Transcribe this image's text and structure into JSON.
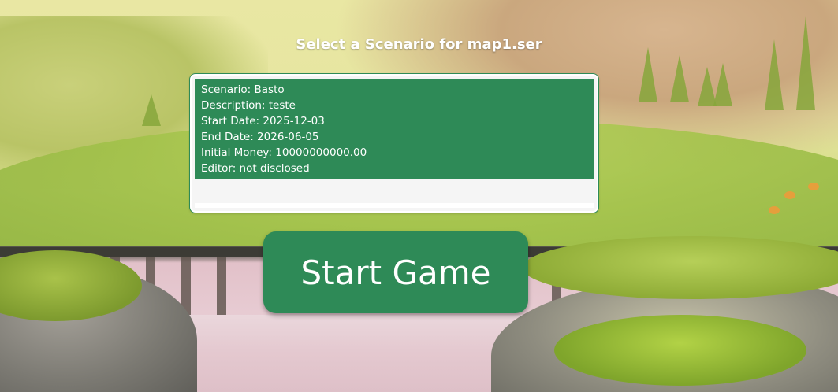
{
  "screen": {
    "title": "Select a Scenario for map1.ser"
  },
  "scenario_list": {
    "items": [
      {
        "scenario": "Scenario: Basto",
        "description": "Description: teste",
        "start_date": "Start Date: 2025-12-03",
        "end_date": "End Date: 2026-06-05",
        "initial_money": "Initial Money: 10000000000.00",
        "editor": "Editor: not disclosed",
        "selected": true
      }
    ]
  },
  "actions": {
    "start_game_label": "Start Game"
  },
  "colors": {
    "accent": "#2e8a57",
    "list_background": "#f5f5f5",
    "text_on_accent": "#ffffff"
  }
}
